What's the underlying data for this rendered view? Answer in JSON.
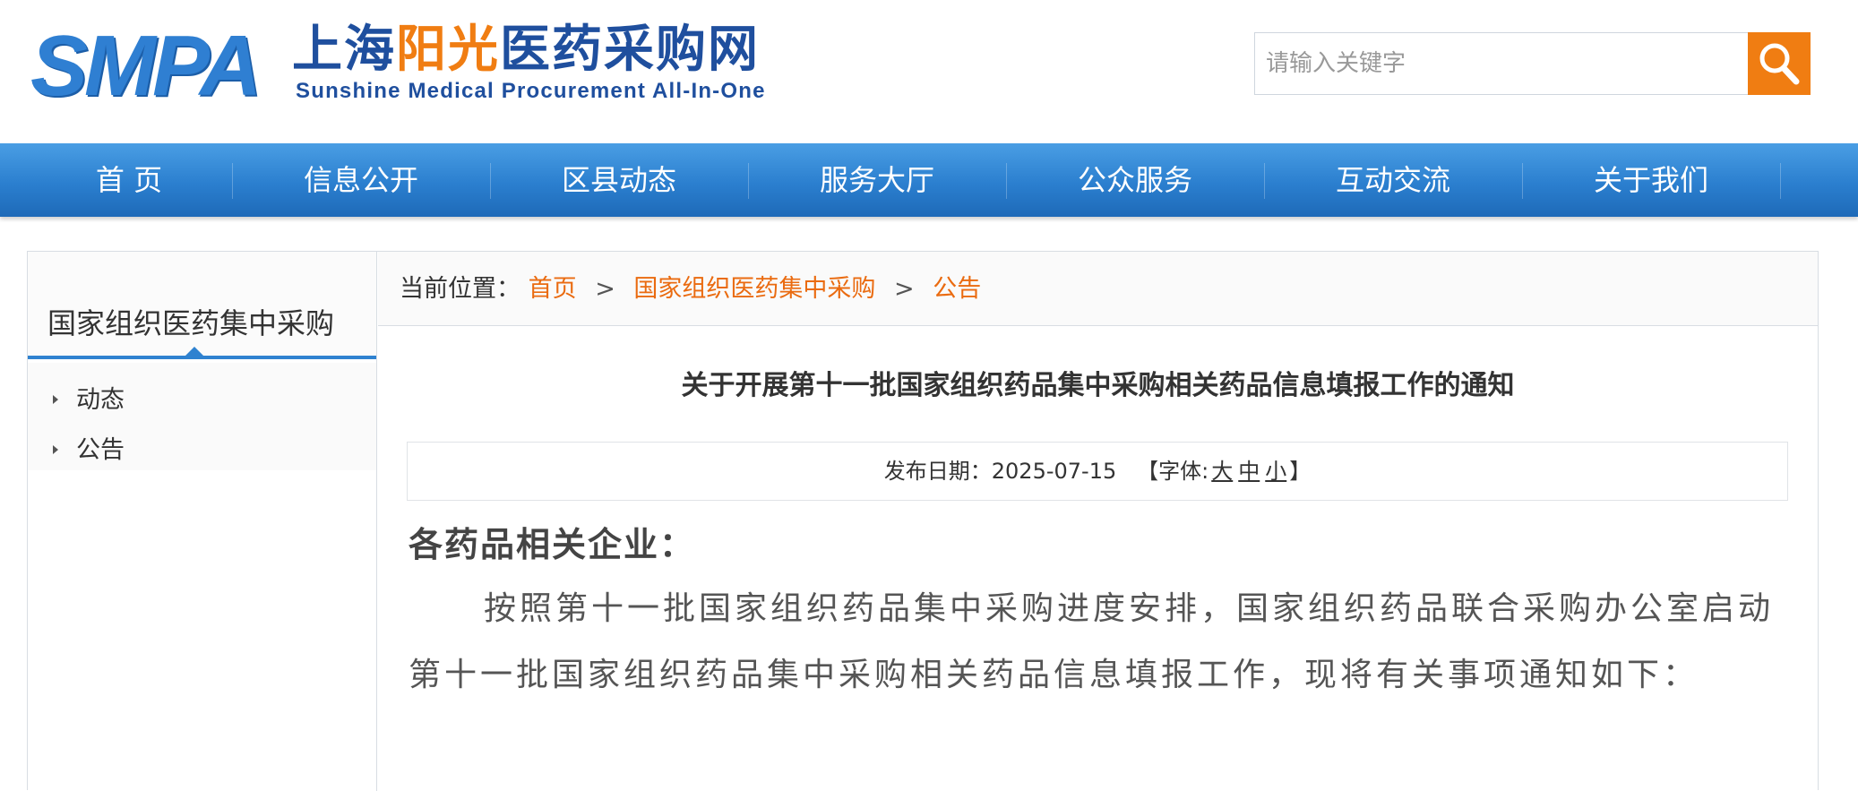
{
  "header": {
    "logo": {
      "abbr": "SMPA",
      "cn_part1": "上海",
      "cn_part2": "阳光",
      "cn_part3": "医药采购网",
      "en": "Sunshine Medical Procurement All-In-One"
    },
    "search": {
      "placeholder": "请输入关键字",
      "value": "",
      "button_icon": "search-icon"
    }
  },
  "nav": {
    "items": [
      {
        "label": "首 页"
      },
      {
        "label": "信息公开"
      },
      {
        "label": "区县动态"
      },
      {
        "label": "服务大厅"
      },
      {
        "label": "公众服务"
      },
      {
        "label": "互动交流"
      },
      {
        "label": "关于我们"
      }
    ]
  },
  "sidebar": {
    "title": "国家组织医药集中采购",
    "items": [
      {
        "label": "动态"
      },
      {
        "label": "公告"
      }
    ]
  },
  "breadcrumb": {
    "label": "当前位置：",
    "items": [
      "首页",
      "国家组织医药集中采购",
      "公告"
    ],
    "separator": ">"
  },
  "article": {
    "title": "关于开展第十一批国家组织药品集中采购相关药品信息填报工作的通知",
    "date_label": "发布日期：",
    "date": "2025-07-15",
    "font_label_open": "【字体:",
    "font_large": "大",
    "font_medium": "中",
    "font_small": "小",
    "font_label_close": "】",
    "salutation": "各药品相关企业：",
    "paragraph": "按照第十一批国家组织药品集中采购进度安排，国家组织药品联合采购办公室启动第十一批国家组织药品集中采购相关药品信息填报工作，现将有关事项通知如下："
  },
  "colors": {
    "brand_blue": "#2f7fd2",
    "accent_orange": "#f07d12",
    "nav_blue": "#2b7fcf"
  }
}
